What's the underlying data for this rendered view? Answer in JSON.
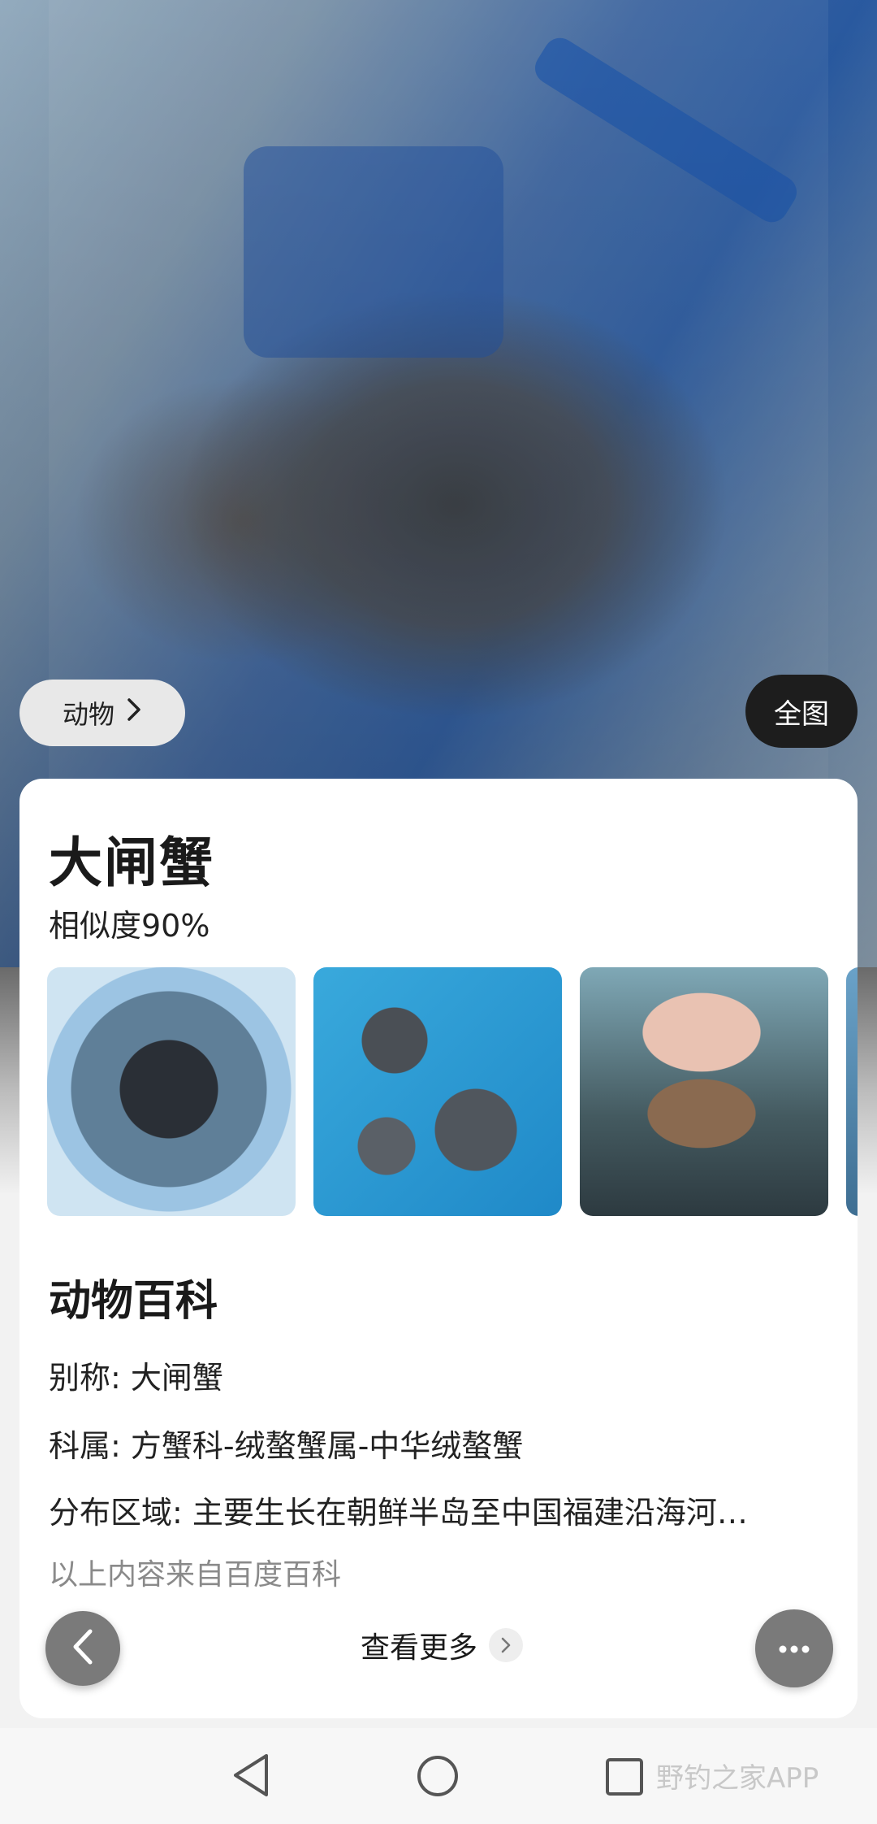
{
  "photo": {
    "category_label": "动物",
    "fullview_label": "全图"
  },
  "result": {
    "title": "大闸蟹",
    "similarity": "相似度90%",
    "thumbnails": [
      "thumb-1",
      "thumb-2",
      "thumb-3",
      "thumb-4"
    ]
  },
  "encyclopedia": {
    "heading": "动物百科",
    "alias": "别称: 大闸蟹",
    "family": "科属: 方蟹科-绒螯蟹属-中华绒螯蟹",
    "distribution": "分布区域: 主要生长在朝鲜半岛至中国福建沿海河…",
    "source_note": "以上内容来自百度百科"
  },
  "actions": {
    "more_label": "查看更多"
  },
  "navbar": {
    "watermark": "野钓之家APP"
  },
  "icons": [
    "chevron-right-icon",
    "back-arrow-icon",
    "more-dots-icon",
    "nav-back-icon",
    "nav-home-icon",
    "nav-recent-icon"
  ]
}
